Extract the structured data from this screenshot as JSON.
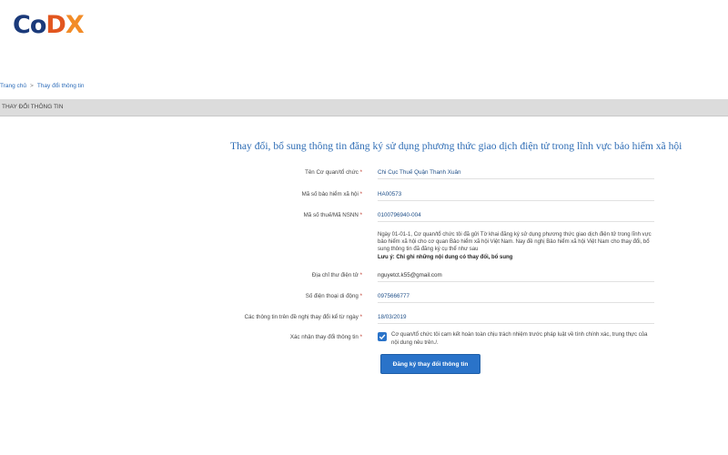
{
  "logo": {
    "c": "C",
    "o": "o",
    "d": "D",
    "x": "X"
  },
  "breadcrumb": {
    "home": "Trang chủ",
    "separator": ">",
    "current": "Thay đổi thông tin"
  },
  "section": {
    "title": "THAY ĐỔI THÔNG TIN"
  },
  "form": {
    "title": "Thay đổi, bổ sung thông tin đăng ký sử dụng phương thức giao dịch điện tử trong lĩnh vực bảo hiểm xã hội",
    "required_mark": "*",
    "fields": [
      {
        "label": "Tên Cơ quan/tổ chức",
        "value": "Chi Cục Thuế Quận Thanh Xuân"
      },
      {
        "label": "Mã số bảo hiểm xã hội",
        "value": "HA00573"
      },
      {
        "label": "Mã số thuế/Mã NSNN",
        "value": "0100796940-004"
      },
      {
        "label": "Địa chỉ thư điện tử",
        "value": "nguyetct.k55@gmail.com"
      },
      {
        "label": "Số điện thoại di động",
        "value": "0975666777"
      },
      {
        "label": "Các thông tin trên đề nghị thay đổi kể từ ngày",
        "value": "18/03/2019"
      },
      {
        "label": "Xác nhận thay đổi thông tin"
      }
    ],
    "notice": {
      "text": "Ngày 01-01-1, Cơ quan/tổ chức tôi đã gửi Tờ khai đăng ký sử dụng phương thức giao dịch điện tử trong lĩnh vực bảo hiểm xã hội cho cơ quan Bảo hiểm xã hội Việt Nam. Nay đề nghị Bảo hiểm xã hội Việt Nam cho thay đổi, bổ sung thông tin đã đăng ký cụ thể như sau",
      "bold": "Lưu ý: Chỉ ghi những nội dung có thay đổi, bổ sung"
    },
    "confirm_text": "Cơ quan/tổ chức tôi cam kết hoàn toàn chịu trách nhiệm trước pháp luật về tính chính xác, trung thực của nội dung nêu trên./.",
    "checkbox_checked": true,
    "submit_label": "Đăng ký thay đổi thông tin"
  },
  "colors": {
    "accent": "#2a73c9",
    "title": "#2f6db5",
    "section_bg": "#dcdcdc",
    "logo_dark": "#1b3a7a",
    "logo_orange": "#e2561f"
  }
}
